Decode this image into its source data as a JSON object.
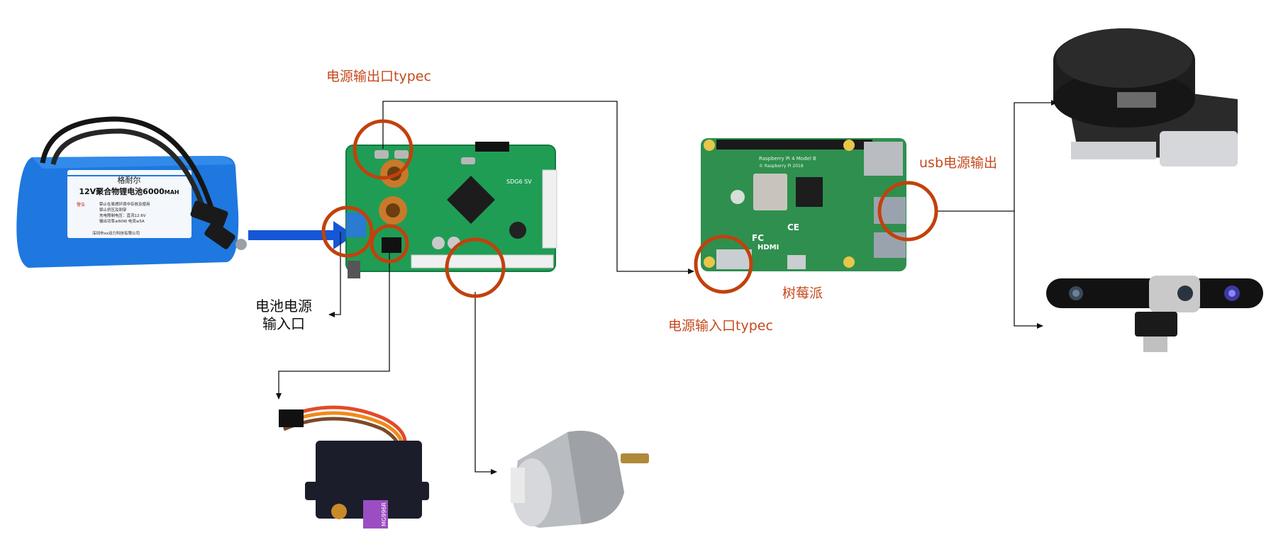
{
  "labels": {
    "power_out_typec": "电源输出口typec",
    "battery_input": "电池电源\n输入口",
    "power_in_typec": "电源输入口typec",
    "raspberry_pi": "树莓派",
    "usb_power_out": "usb电源输出"
  },
  "battery": {
    "brand": "格耐尔",
    "title": "12V聚合物锂电池6000",
    "unit": "MAH",
    "warn": "警告",
    "notes": [
      "禁止在易燃环境中存放及使用",
      "禁止挤压及刺穿",
      "充电限制电压：直流12.6V",
      "输出功率≤60W 电流≤5A"
    ],
    "maker": "深圳市xx动力科技有限公司"
  },
  "board": {
    "silk": "SDG6 SV"
  },
  "raspberry_pi_board": {
    "silk1": "Raspberry Pi 4 Model B",
    "silk2": "© Raspberry Pi 2018",
    "hdmi": "HDMI",
    "fc": "FC",
    "ce": "CE"
  },
  "servo": {
    "model": "MG996R"
  },
  "colors": {
    "accent": "#c6491c",
    "ring": "#c2410c",
    "arrow_blue": "#1557d6",
    "battery_blue": "#1f7be0",
    "pcb_green": "#1f9d55",
    "pi_green": "#2f8f4e"
  }
}
